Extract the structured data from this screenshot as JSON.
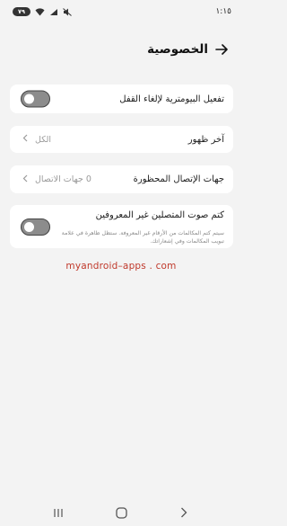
{
  "status_bar": {
    "time": "١:١٥",
    "battery": "٧٩"
  },
  "header": {
    "title": "الخصوصية"
  },
  "settings": {
    "biometric_unlock": {
      "label": "تفعيل البيومترية لإلغاء القفل",
      "enabled": false
    },
    "last_seen": {
      "label": "آخر ظهور",
      "value": "الكل"
    },
    "blocked_contacts": {
      "label": "جهات الإتصال المحظورة",
      "value": "0 جهات الاتصال"
    },
    "silence_unknown": {
      "label": "كتم صوت المتصلين غير المعروفين",
      "description": "سيتم كتم المكالمات من الأرقام غير المعروفة. ستظل ظاهرة في علامة تبويب المكالمات وفي إشعاراتك.",
      "enabled": false
    }
  },
  "watermark": "myandroid–apps . com",
  "colors": {
    "background": "#f3f3f3",
    "card": "#ffffff",
    "toggle_off": "#8c8c8c",
    "watermark": "#c0392b"
  }
}
